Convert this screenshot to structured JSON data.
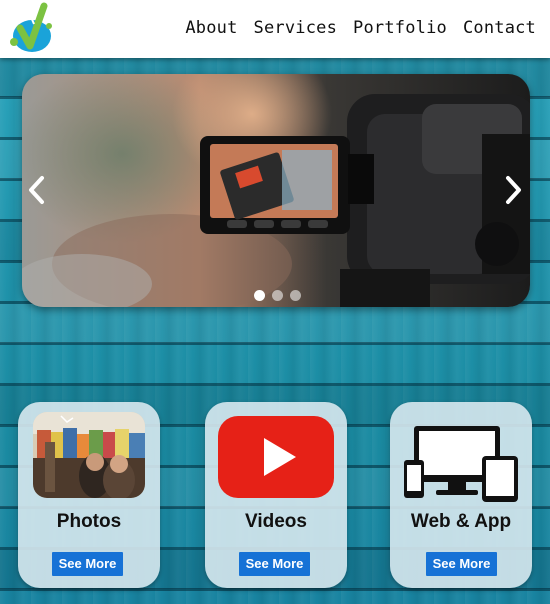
{
  "nav": {
    "links": [
      {
        "label": "About"
      },
      {
        "label": "Services"
      },
      {
        "label": "Portfolio"
      },
      {
        "label": "Contact"
      }
    ]
  },
  "slider": {
    "slide_count": 3,
    "active_slide": 1
  },
  "cards": [
    {
      "title": "Photos",
      "button": "See More"
    },
    {
      "title": "Videos",
      "button": "See More"
    },
    {
      "title": "Web & App",
      "button": "See More"
    }
  ],
  "colors": {
    "header_bg": "#ffffff",
    "wood": "#1f93ab",
    "button": "#1672d6",
    "youtube_red": "#e62117",
    "logo_green": "#7cc242",
    "logo_blue": "#1aa3d9"
  },
  "icons": {
    "prev": "chevron-left-icon",
    "next": "chevron-right-icon",
    "videos": "youtube-play-icon",
    "web": "devices-icon"
  }
}
